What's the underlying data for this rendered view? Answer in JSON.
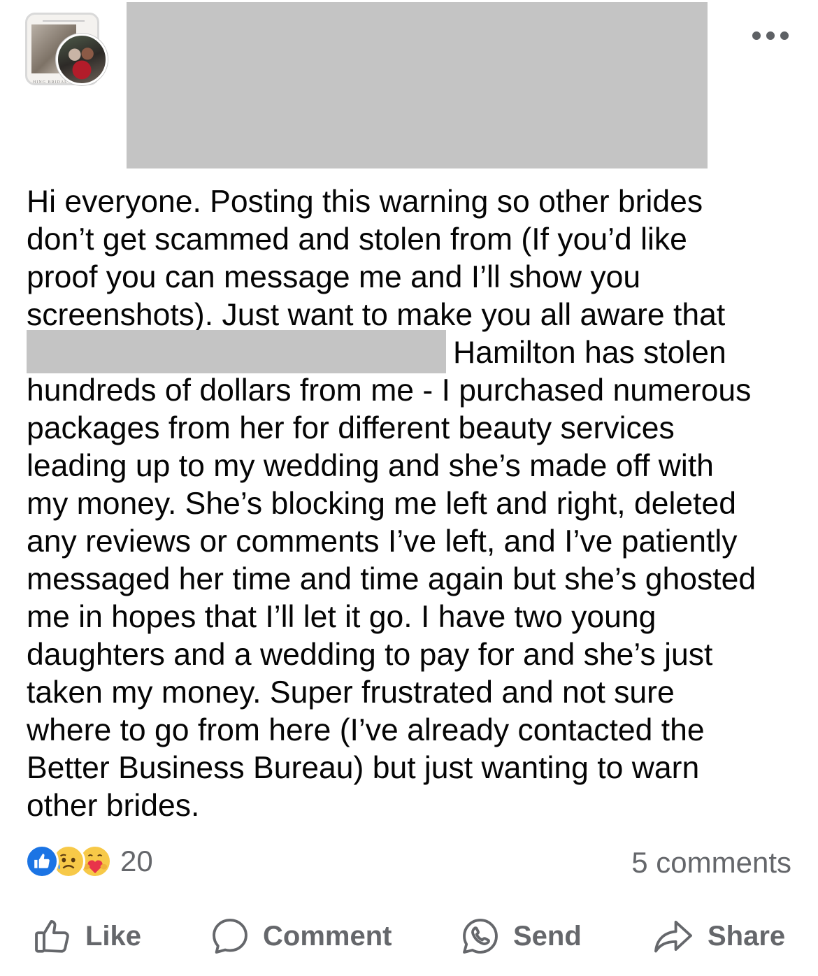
{
  "header": {
    "avatar_watermark": "HING BRIDAL",
    "more_icon": "more-horizontal-icon"
  },
  "post": {
    "lines": [
      "Hi everyone. Posting this warning so other brides",
      "don’t get scammed and stolen from (If you’d like",
      "proof you can message me and I’ll show you",
      "screenshots). Just want to make you all aware that",
      "Hamilton has stolen",
      "hundreds of dollars from me - I purchased numerous",
      "packages from her for different beauty services",
      "leading up to my wedding and she’s made off with",
      "my money. She’s blocking me left and right, deleted",
      "any reviews or comments I’ve left, and I’ve patiently",
      "messaged her time and time again but she’s ghosted",
      "me in hopes that I’ll let it go. I have two young",
      "daughters and a wedding to pay for and she’s just",
      "taken my money. Super frustrated and not sure",
      "where to go from here (I’ve already contacted the",
      "Better Business Bureau) but just wanting to warn",
      "other brides."
    ]
  },
  "stats": {
    "reactions": [
      "like-reaction-icon",
      "sad-reaction-icon",
      "care-reaction-icon"
    ],
    "reaction_count": "20",
    "comments": "5 comments"
  },
  "actions": {
    "like": "Like",
    "comment": "Comment",
    "send": "Send",
    "share": "Share"
  },
  "colors": {
    "like_blue": "#1b74e4",
    "secondary_text": "#65676b",
    "redaction_gray": "#c4c4c4"
  }
}
